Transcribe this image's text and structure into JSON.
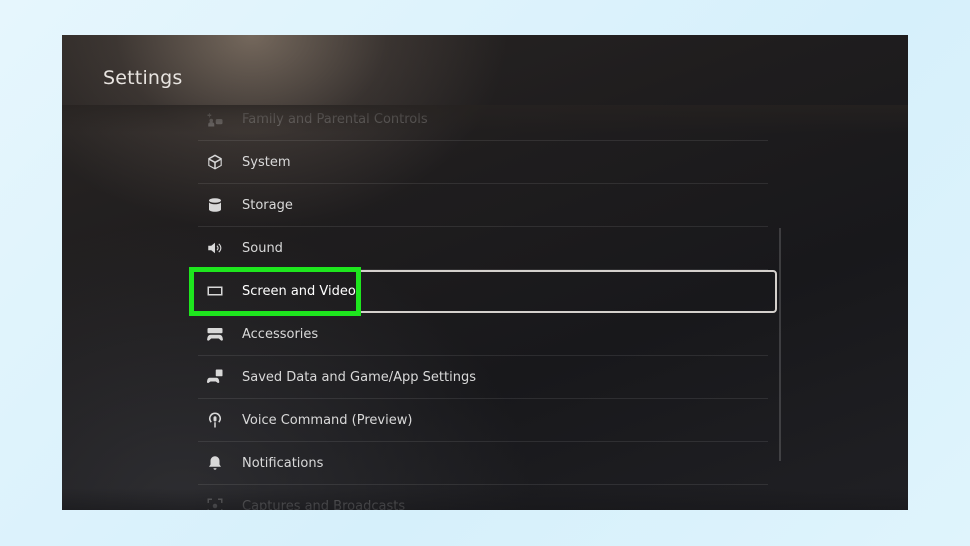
{
  "screen": {
    "title": "Settings"
  },
  "menu": {
    "items": [
      {
        "label": "Family and Parental Controls",
        "icon": "family-icon",
        "state": "faded"
      },
      {
        "label": "System",
        "icon": "system-cube-icon",
        "state": "normal"
      },
      {
        "label": "Storage",
        "icon": "storage-drum-icon",
        "state": "normal"
      },
      {
        "label": "Sound",
        "icon": "speaker-icon",
        "state": "normal"
      },
      {
        "label": "Screen and Video",
        "icon": "screen-icon",
        "state": "selected"
      },
      {
        "label": "Accessories",
        "icon": "accessories-icon",
        "state": "normal"
      },
      {
        "label": "Saved Data and Game/App Settings",
        "icon": "saved-data-icon",
        "state": "normal"
      },
      {
        "label": "Voice Command (Preview)",
        "icon": "voice-command-icon",
        "state": "normal"
      },
      {
        "label": "Notifications",
        "icon": "bell-icon",
        "state": "normal"
      },
      {
        "label": "Captures and Broadcasts",
        "icon": "captures-icon",
        "state": "faded"
      }
    ]
  },
  "annotation": {
    "color": "#1ee61e"
  },
  "colors": {
    "focus_frame": "#d4d0cc",
    "text": "#d9d9d9",
    "outer_background": "#dff4fc"
  }
}
